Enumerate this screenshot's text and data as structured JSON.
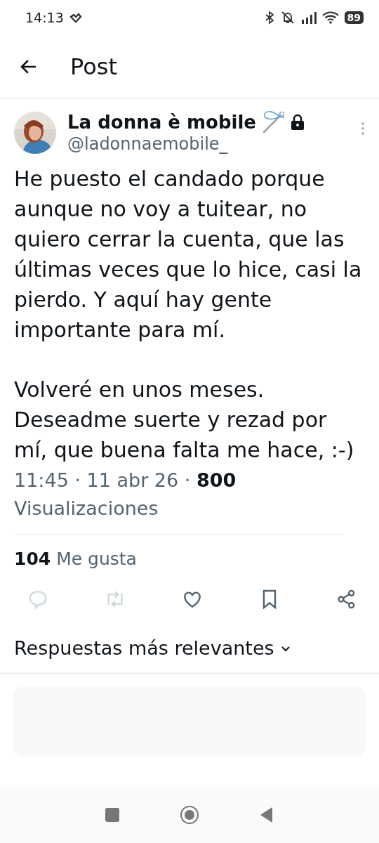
{
  "status_bar": {
    "time": "14:13",
    "battery": "89"
  },
  "header": {
    "title": "Post"
  },
  "post": {
    "author": "La donna è mobile",
    "handle": "@ladonnaemobile_",
    "protected": true,
    "paragraphs": [
      "He puesto el candado porque aunque no voy a tuitear, no quiero cerrar la cuenta, que las últimas veces que lo hice, casi la pierdo. Y aquí hay gente importante para mí.",
      "Volveré en unos meses. Deseadme suerte y rezad por mí, que buena falta me hace, :-)"
    ],
    "meta": "11:45 · 11 abr 26 · **800** Visualizaciones",
    "likes": "**104** Me gusta",
    "actions": [
      {
        "kind": "reply",
        "disabled": true
      },
      {
        "kind": "repost",
        "disabled": true
      },
      {
        "kind": "like",
        "disabled": false
      },
      {
        "kind": "bookmark",
        "disabled": false
      },
      {
        "kind": "share",
        "disabled": false
      }
    ]
  },
  "replies_sort": {
    "label": "Respuestas más relevantes"
  }
}
